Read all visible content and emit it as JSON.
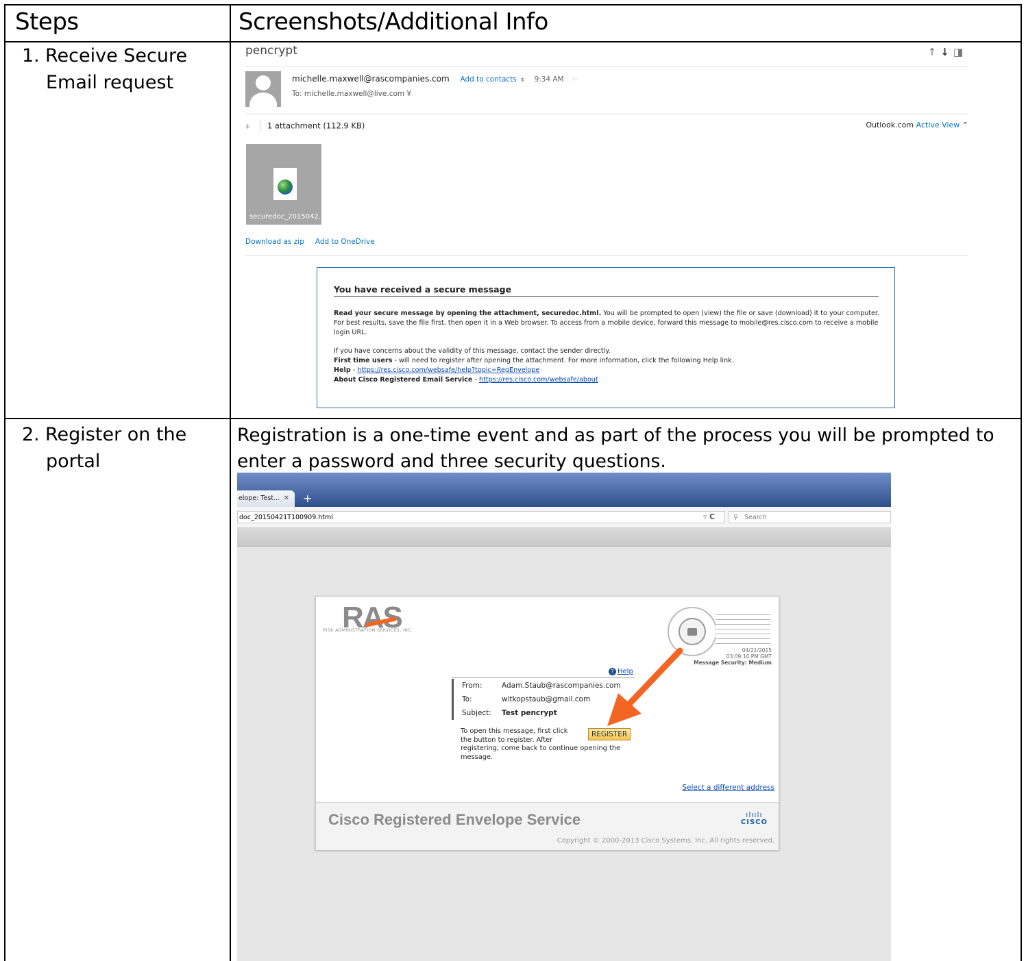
{
  "table": {
    "header_steps": "Steps",
    "header_info": "Screenshots/Additional Info"
  },
  "steps": [
    {
      "number": "1.",
      "line1": "Receive Secure",
      "line2": "Email request"
    },
    {
      "number": "2.",
      "line1": "Register on the",
      "line2": "portal"
    }
  ],
  "step2_intro": "Registration is a one-time event and as part of the process you will be prompted to enter a password and three security questions.",
  "outlook": {
    "subject": "pencrypt",
    "from": "michelle.maxwell@rascompanies.com",
    "add_contacts": "Add to contacts",
    "time": "9:34 AM",
    "to": "To: michelle.maxwell@live.com",
    "attachment_summary": "1 attachment (112.9 KB)",
    "outlook_label": "Outlook.com",
    "active_view": "Active View",
    "attachment_name": "securedoc_2015042...",
    "download_zip": "Download as zip",
    "add_onedrive": "Add to OneDrive",
    "secure_title": "You have received a secure message",
    "p1_bold": "Read your secure message by opening the attachment, securedoc.html.",
    "p1_rest": " You will be prompted to open (view) the file or save (download) it to your computer. For best results, save the file first, then open it in a Web browser. To access from a mobile device, forward this message to mobile@res.cisco.com to receive a mobile login URL.",
    "p2": "If you have concerns about the validity of this message, contact the sender directly.",
    "first_time_label": "First time users",
    "first_time_text": " - will need to register after opening the attachment. For more information, click the following Help link.",
    "help_label": "Help",
    "help_url": "https://res.cisco.com/websafe/help?topic=RegEnvelope",
    "about_label": "About Cisco Registered Email Service",
    "about_url": "https://res.cisco.com/websafe/about"
  },
  "browser": {
    "tab_title": "elope: Test...",
    "url": "doc_20150421T100909.html",
    "search_placeholder": "Search",
    "ras_logo": "RAS",
    "ras_subtitle": "RISK ADMINISTRATION SERVICES, INC.",
    "postmark_date": "04/21/2015",
    "postmark_time": "03:09:10 PM GMT",
    "message_security": "Message Security: Medium",
    "help_link": "Help",
    "from_label": "From:",
    "from_value": "Adam.Staub@rascompanies.com",
    "to_label": "To:",
    "to_value": "witkopstaub@gmail.com",
    "subject_label": "Subject:",
    "subject_value": "Test pencrypt",
    "instructions_a": "To open this message, first click the button to register. After",
    "instructions_b": "registering, come back to continue opening the message.",
    "register_button": "REGISTER",
    "different_address": "Select a different address",
    "service_name": "Cisco Registered Envelope Service",
    "cisco_word": "CISCO",
    "copyright": "Copyright © 2000-2013 Cisco Systems, Inc. All rights reserved."
  },
  "colors": {
    "accent_blue": "#0072c6",
    "arrow_orange": "#f26522",
    "box_border": "#2e6fa3"
  }
}
